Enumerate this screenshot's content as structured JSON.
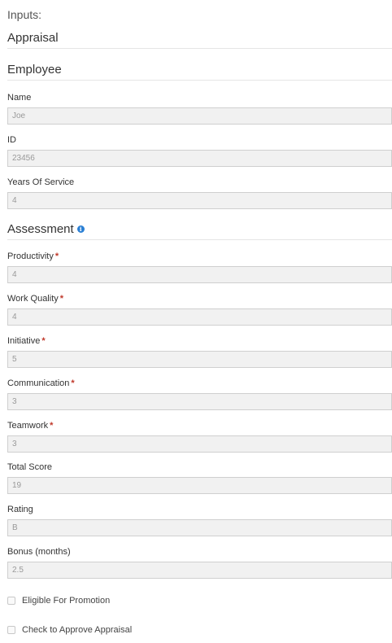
{
  "inputs_title": "Inputs:",
  "appraisal_title": "Appraisal",
  "employee": {
    "title": "Employee",
    "name": {
      "label": "Name",
      "value": "Joe"
    },
    "id": {
      "label": "ID",
      "value": "23456"
    },
    "years_of_service": {
      "label": "Years Of Service",
      "value": "4"
    }
  },
  "assessment": {
    "title": "Assessment",
    "info_icon": "info-icon",
    "required_marker": "*",
    "productivity": {
      "label": "Productivity",
      "value": "4"
    },
    "work_quality": {
      "label": "Work Quality",
      "value": "4"
    },
    "initiative": {
      "label": "Initiative",
      "value": "5"
    },
    "communication": {
      "label": "Communication",
      "value": "3"
    },
    "teamwork": {
      "label": "Teamwork",
      "value": "3"
    },
    "total_score": {
      "label": "Total Score",
      "value": "19"
    },
    "rating": {
      "label": "Rating",
      "value": "B"
    },
    "bonus_months": {
      "label": "Bonus (months)",
      "value": "2.5"
    }
  },
  "checkboxes": {
    "eligible_for_promotion": {
      "label": "Eligible For Promotion",
      "checked": false
    },
    "approve_appraisal": {
      "label": "Check to Approve Appraisal",
      "checked": false
    }
  },
  "colors": {
    "required": "#c0392b",
    "info_icon": "#2a7fd4",
    "input_background": "#f1f1f1"
  }
}
